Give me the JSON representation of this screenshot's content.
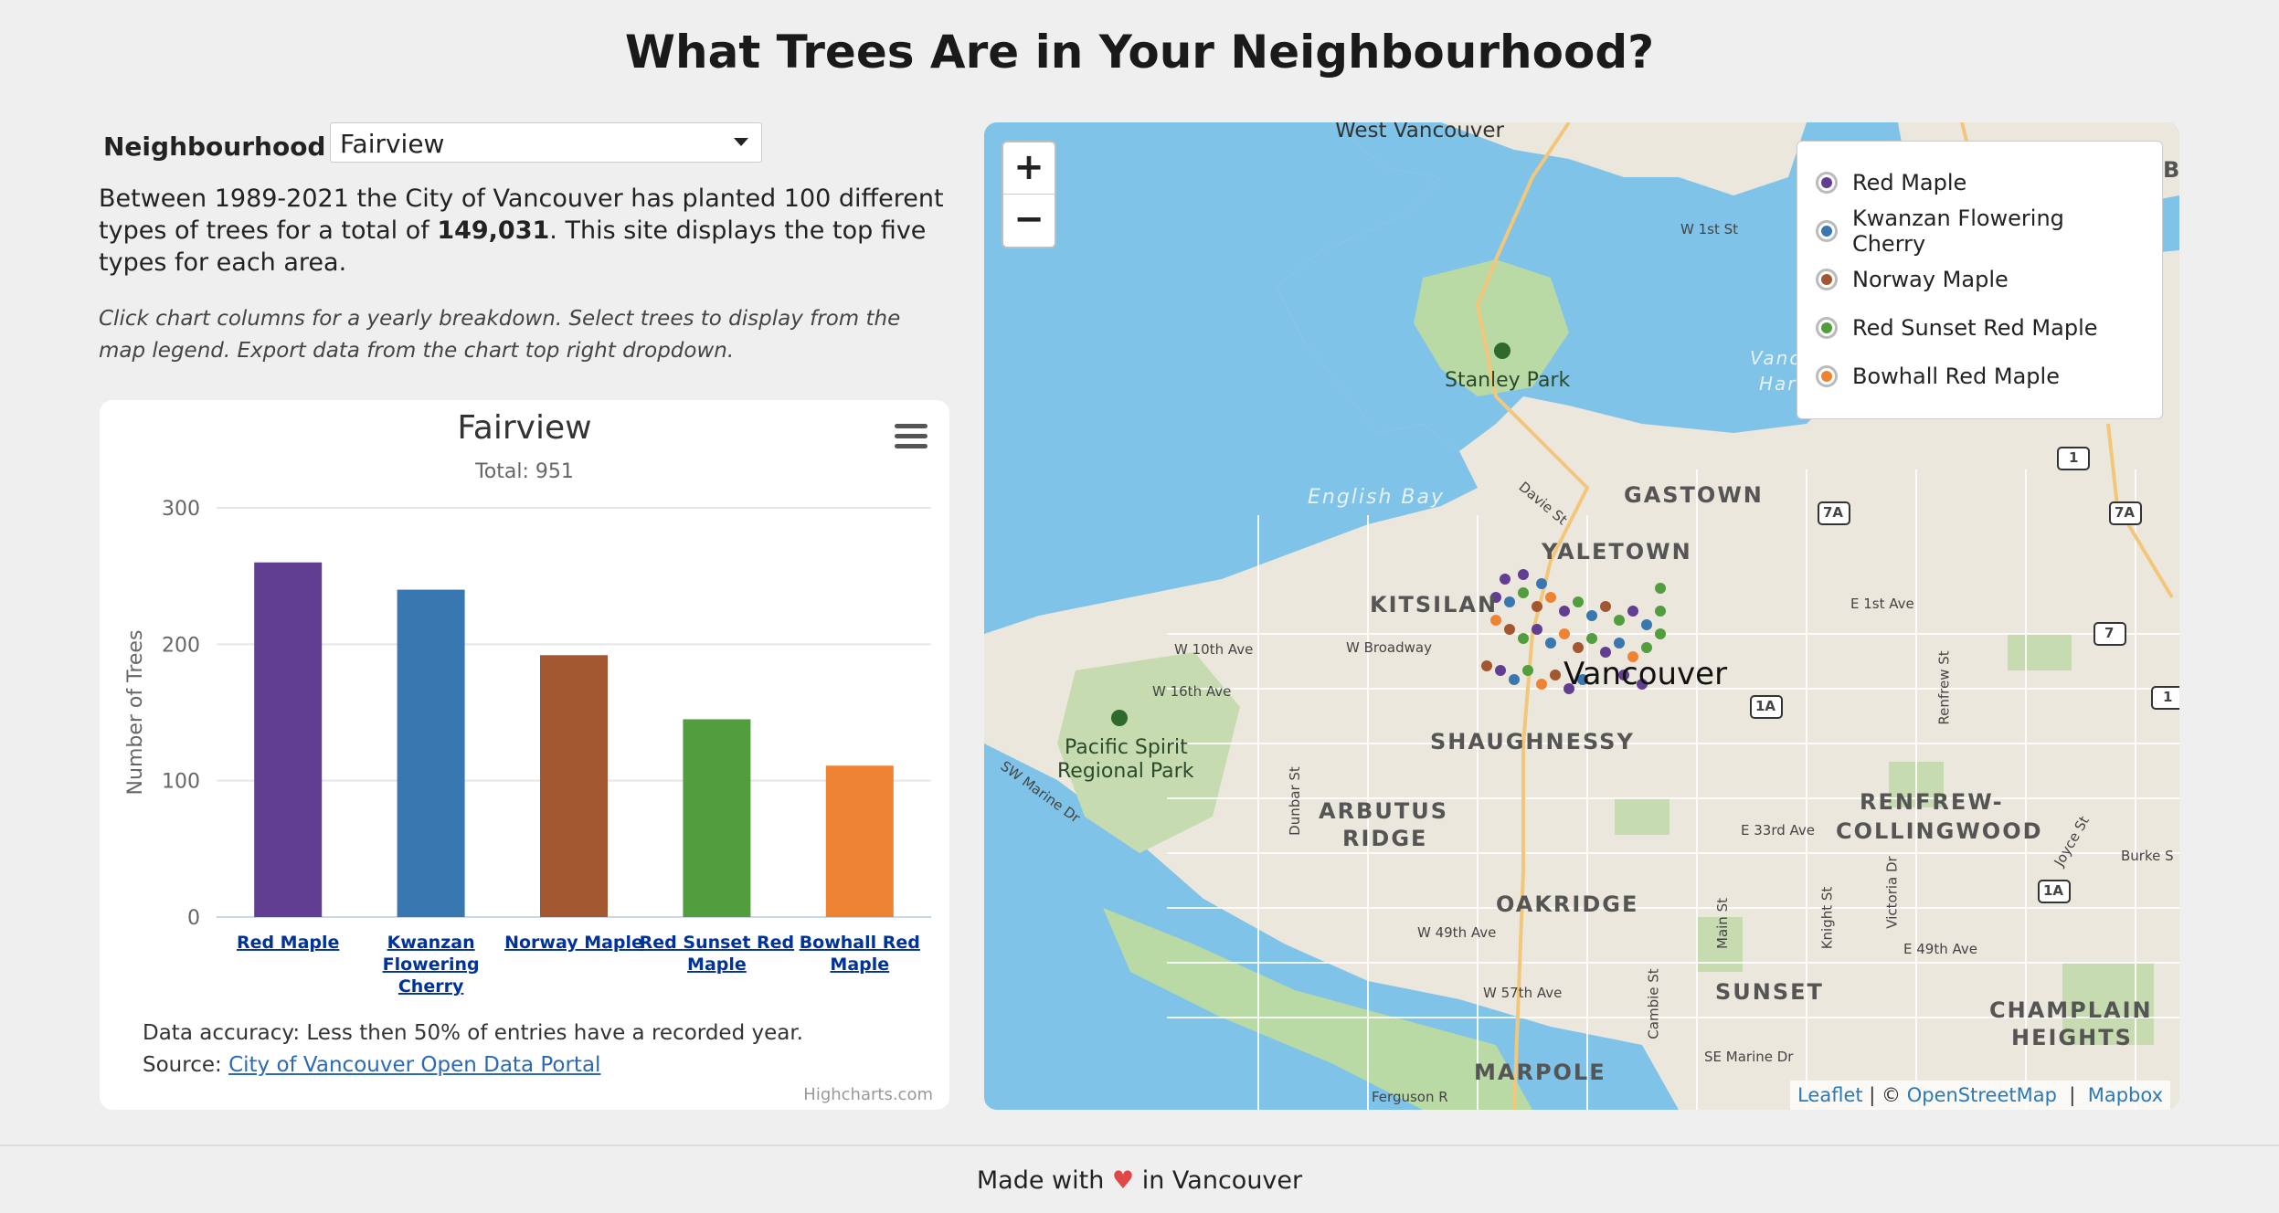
{
  "page": {
    "title": "What Trees Are in Your Neighbourhood?"
  },
  "controls": {
    "neighbourhood_label": "Neighbourhood",
    "selected": "Fairview"
  },
  "intro": {
    "part1": "Between 1989-2021 the City of Vancouver has planted 100 different types of trees for a total of ",
    "total": "149,031",
    "part2": ". This site displays the top five types for each area."
  },
  "hint": "Click chart columns for a yearly breakdown. Select trees to display from the map legend. Export data from the chart top right dropdown.",
  "chart_card": {
    "accuracy": "Data accuracy: Less then 50% of entries have a recorded year.",
    "source_prefix": "Source: ",
    "source_link": "City of Vancouver Open Data Portal",
    "credits": "Highcharts.com"
  },
  "chart_data": {
    "type": "bar",
    "title": "Fairview",
    "subtitle": "Total: 951",
    "ylabel": "Number of Trees",
    "xlabel": "",
    "ylim": [
      0,
      300
    ],
    "yticks": [
      0,
      100,
      200,
      300
    ],
    "categories": [
      "Red Maple",
      "Kwanzan Flowering Cherry",
      "Norway Maple",
      "Red Sunset Red Maple",
      "Bowhall Red Maple"
    ],
    "category_lines": [
      [
        "Red Maple"
      ],
      [
        "Kwanzan",
        "Flowering",
        "Cherry"
      ],
      [
        "Norway Maple"
      ],
      [
        "Red Sunset Red",
        "Maple"
      ],
      [
        "Bowhall Red",
        "Maple"
      ]
    ],
    "values": [
      260,
      240,
      192,
      145,
      111
    ],
    "colors": [
      "#623e93",
      "#3877b0",
      "#a25730",
      "#529d3e",
      "#ee8433"
    ],
    "grid": true,
    "legend": "none"
  },
  "map": {
    "zoom_in": "+",
    "zoom_out": "−",
    "legend": [
      {
        "label": "Red Maple",
        "color": "#623e93"
      },
      {
        "label": "Kwanzan Flowering Cherry",
        "color": "#3877b0"
      },
      {
        "label": "Norway Maple",
        "color": "#a25730"
      },
      {
        "label": "Red Sunset Red Maple",
        "color": "#529d3e"
      },
      {
        "label": "Bowhall Red Maple",
        "color": "#ee8433"
      }
    ],
    "labels": {
      "west_vancouver": "West Vancouver",
      "stanley_park": "Stanley Park",
      "english_bay": "English Bay",
      "gastown": "GASTOWN",
      "yaletown": "YALETOWN",
      "kitsilano": "KITSILAN",
      "vancouver": "Vancouver",
      "shaughnessy": "SHAUGHNESSY",
      "pacific_spirit": "Pacific Spirit",
      "regional_park": "Regional Park",
      "arbutus": "ARBUTUS",
      "ridge": "RIDGE",
      "renfrew": "RENFREW-",
      "collingwood": "COLLINGWOOD",
      "oakridge": "OAKRIDGE",
      "sunset": "SUNSET",
      "champlain": "CHAMPLAIN",
      "heights": "HEIGHTS",
      "marpole": "MARPOLE",
      "vancouver_harbour_1": "Vancouv",
      "vancouver_harbour_2": "Harbo",
      "w10th": "W 10th Ave",
      "wbroadway": "W Broadway",
      "w16th": "W 16th Ave",
      "w49th": "W 49th Ave",
      "w57th": "W 57th Ave",
      "e1st": "E 1st Ave",
      "e33rd": "E 33rd Ave",
      "e49th": "E 49th Ave",
      "se_marine": "SE Marine Dr",
      "w1st": "W 1st St",
      "davie": "Davie St",
      "dunbar": "Dunbar St",
      "sw_marine": "SW Marine Dr",
      "main": "Main St",
      "knight": "Knight St",
      "victoria": "Victoria Dr",
      "joyce": "Joyce St",
      "renfrew_st": "Renfrew St",
      "cambie": "Cambie St",
      "burke": "Burke S",
      "ferguson": "Ferguson R",
      "shield_1": "1",
      "shield_7a": "7A",
      "shield_7": "7",
      "shield_1a": "1A",
      "bi": "BI"
    },
    "attribution": {
      "leaflet": "Leaflet",
      "sep": " | © ",
      "osm": "OpenStreetMap",
      "sep2": "  |  ",
      "mapbox": "Mapbox"
    }
  },
  "footer": {
    "before": "Made with ",
    "heart": "♥",
    "after": " in Vancouver"
  }
}
